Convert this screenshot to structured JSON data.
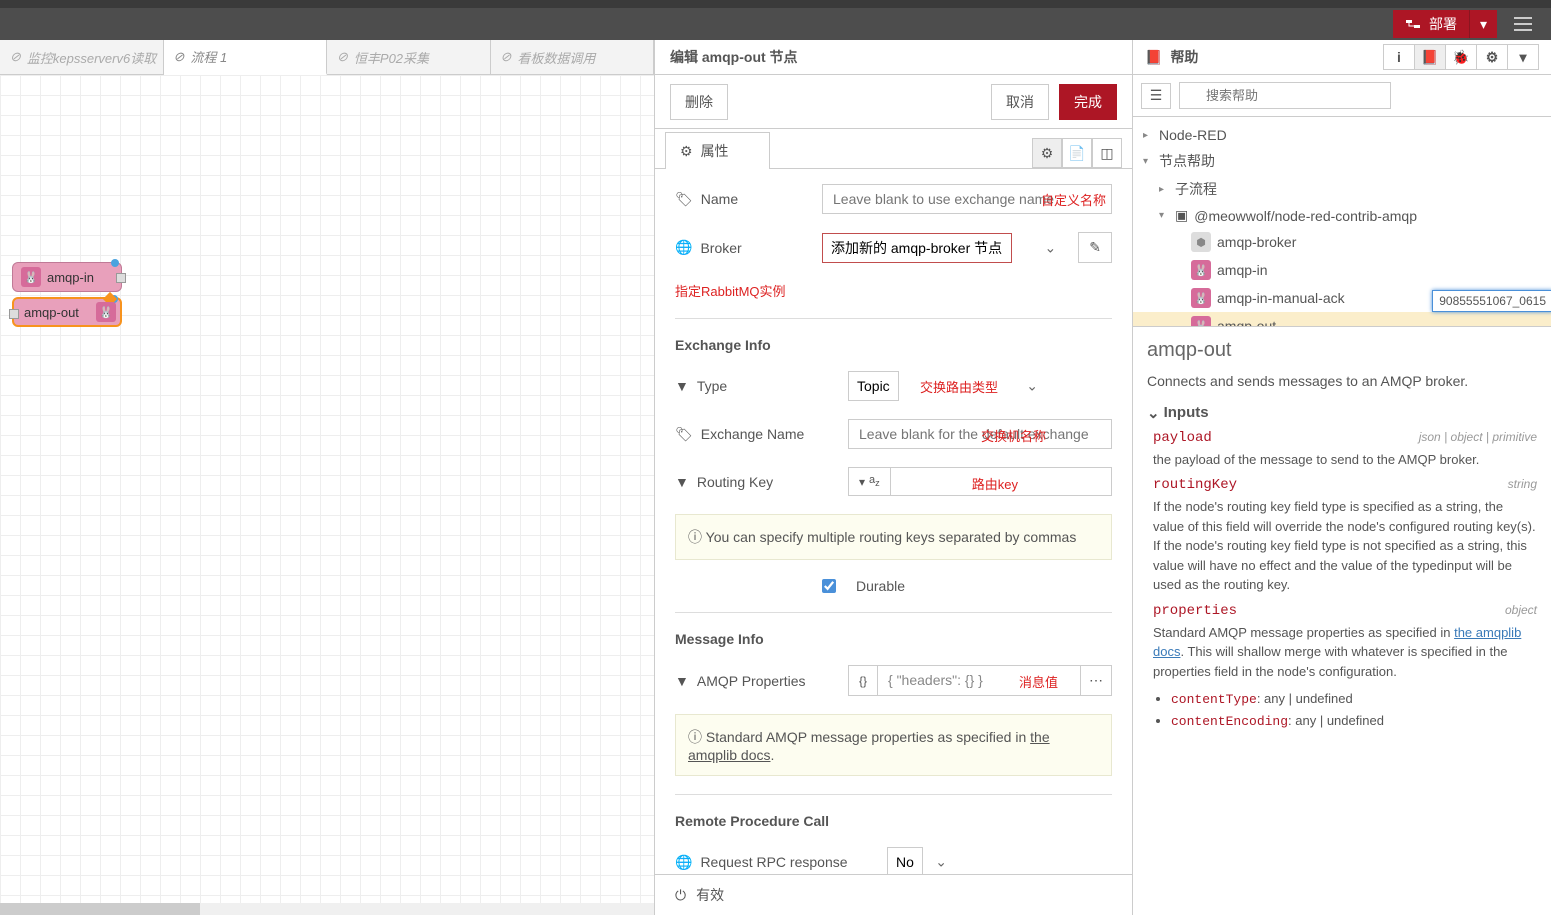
{
  "topbar": {
    "deploy": "部署"
  },
  "tabs": [
    {
      "label": "监控kepsserverv6读取"
    },
    {
      "label": "流程 1"
    },
    {
      "label": "恒丰P02采集"
    },
    {
      "label": "看板数据调用"
    }
  ],
  "canvas_nodes": {
    "in": "amqp-in",
    "out": "amqp-out"
  },
  "editor": {
    "title": "编辑 amqp-out 节点",
    "delete": "删除",
    "cancel": "取消",
    "done": "完成",
    "props_tab": "属性",
    "fields": {
      "name_label": "Name",
      "name_ph": "Leave blank to use exchange name",
      "name_annot": "自定义名称",
      "broker_label": "Broker",
      "broker_value": "添加新的 amqp-broker 节点",
      "broker_annot": "指定RabbitMQ实例",
      "exchange_section": "Exchange Info",
      "type_label": "Type",
      "type_value": "Topic",
      "type_annot": "交换路由类型",
      "exname_label": "Exchange Name",
      "exname_ph": "Leave blank for the default exchange",
      "exname_annot": "交换机名称",
      "rkey_label": "Routing Key",
      "rkey_type": "a_z",
      "rkey_annot": "路由key",
      "rkey_hint": "You can specify multiple routing keys separated by commas",
      "durable_label": "Durable",
      "msg_section": "Message Info",
      "amqp_label": "AMQP Properties",
      "amqp_value": "{ \"headers\": {} }",
      "amqp_annot": "消息值",
      "amqp_hint_prefix": "Standard AMQP message properties as specified in ",
      "amqp_hint_link": "the amqplib docs",
      "rpc_section": "Remote Procedure Call",
      "rpc_label": "Request RPC response",
      "rpc_value": "No"
    },
    "footer_valid": "有效"
  },
  "help": {
    "title": "帮助",
    "search_ph": "搜索帮助",
    "tree": {
      "root": "Node-RED",
      "nodehelp": "节点帮助",
      "subflow": "子流程",
      "pkg": "@meowwolf/node-red-contrib-amqp",
      "items": [
        "amqp-broker",
        "amqp-in",
        "amqp-in-manual-ack",
        "amqp-out"
      ]
    },
    "tooltip": "90855551067_0615",
    "doc": {
      "h2": "amqp-out",
      "intro": "Connects and sends messages to an AMQP broker.",
      "inputs_h": "Inputs",
      "payload_name": "payload",
      "payload_type": "json | object | primitive",
      "payload_desc": "the payload of the message to send to the AMQP broker.",
      "rkey_name": "routingKey",
      "rkey_type": "string",
      "rkey_desc": "If the node's routing key field type is specified as a string, the value of this field will override the node's configured routing key(s). If the node's routing key field type is not specified as a string, this value will have no effect and the value of the typedinput will be used as the routing key.",
      "props_name": "properties",
      "props_type": "object",
      "props_desc_prefix": "Standard AMQP message properties as specified in ",
      "props_desc_link": "the amqplib docs",
      "props_desc_suffix": ". This will shallow merge with whatever is specified in the properties field in the node's configuration.",
      "li1_name": "contentType",
      "li1_rest": ": any | undefined",
      "li2_name": "contentEncoding",
      "li2_rest": ": any | undefined"
    }
  }
}
